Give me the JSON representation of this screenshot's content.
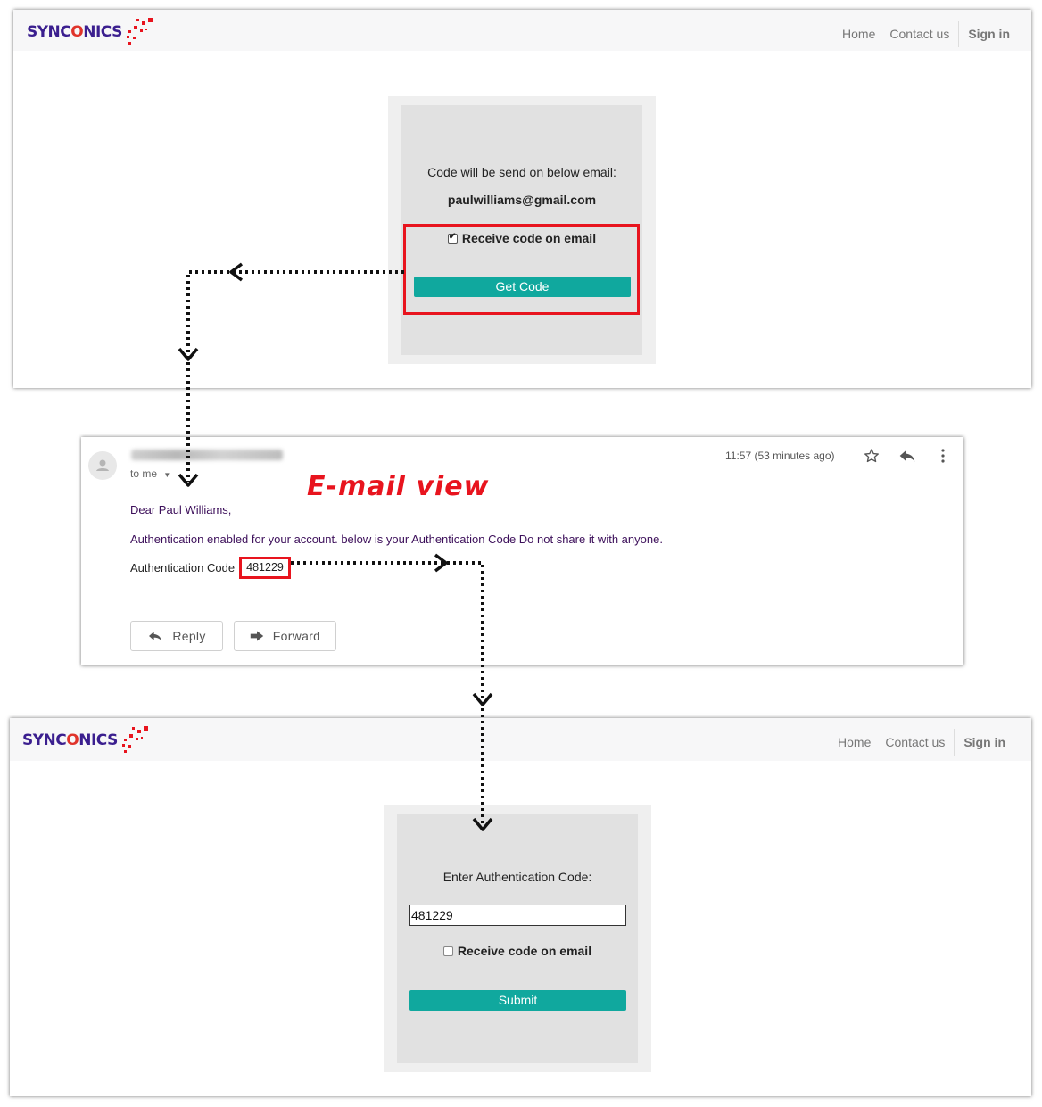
{
  "brand": {
    "logo_text_a": "SYNC",
    "logo_text_o": "O",
    "logo_text_b": "NICS"
  },
  "nav": {
    "home": "Home",
    "contact": "Contact us",
    "signin": "Sign in"
  },
  "step1": {
    "instruction": "Code will be send on below email:",
    "email": "paulwilliams@gmail.com",
    "checkbox_label": "Receive code on email",
    "checkbox_checked": true,
    "button_label": "Get Code"
  },
  "email_view": {
    "annotation": "E-mail view",
    "to_label": "to me",
    "time": "11:57 (53 minutes ago)",
    "greeting": "Dear Paul Williams,",
    "body": "Authentication enabled for your account. below is your Authentication Code Do not share it with anyone.",
    "code_label": "Authentication Code",
    "code": "481229",
    "reply_label": "Reply",
    "forward_label": "Forward"
  },
  "step2": {
    "instruction": "Enter Authentication Code:",
    "input_value": "481229",
    "checkbox_label": "Receive code on email",
    "checkbox_checked": false,
    "button_label": "Submit"
  },
  "colors": {
    "accent": "#10a89e",
    "highlight": "#e8141e",
    "brand": "#3b1f8f"
  }
}
